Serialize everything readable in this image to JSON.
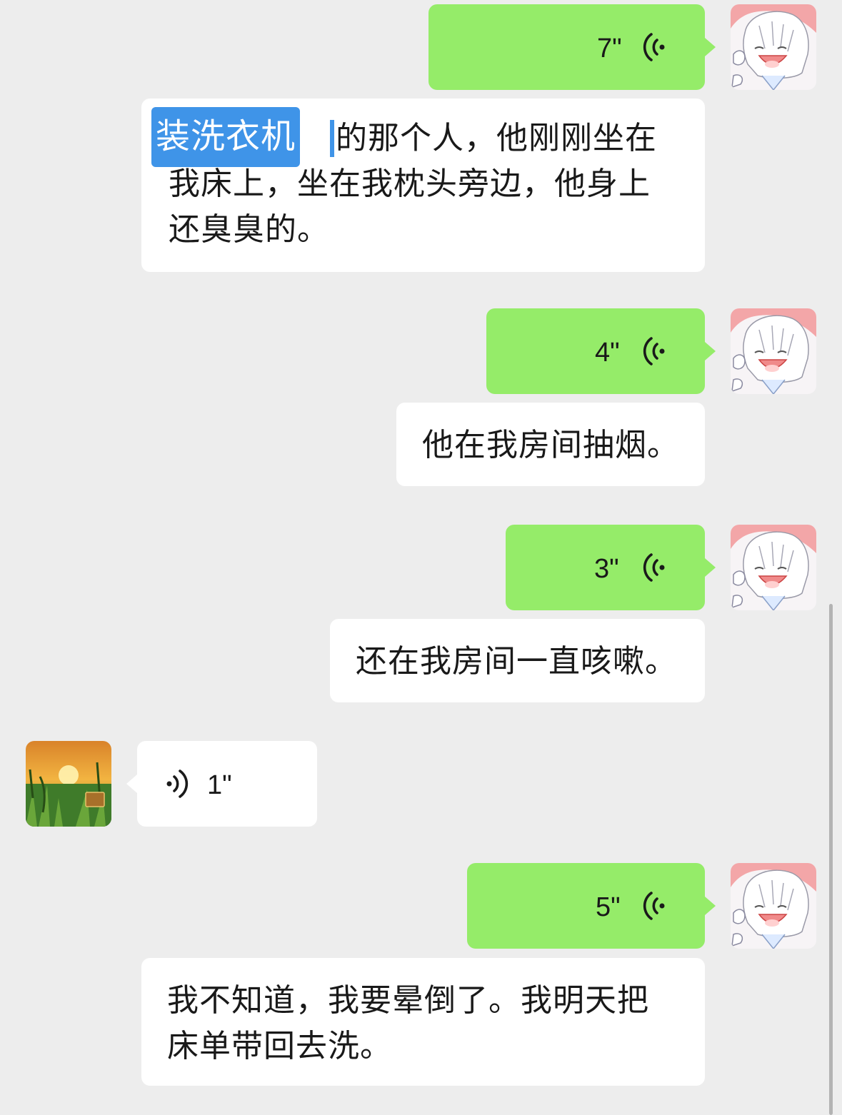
{
  "chat": {
    "messages": [
      {
        "side": "right",
        "type": "voice",
        "duration": "7\""
      },
      {
        "side": "right",
        "type": "text",
        "selected_text": "装洗衣机",
        "text_line1": "的那个人，他刚刚坐在",
        "text_line2": "我床上，坐在我枕头旁边，他身上",
        "text_line3": "还臭臭的。"
      },
      {
        "side": "right",
        "type": "voice",
        "duration": "4\""
      },
      {
        "side": "right",
        "type": "text",
        "text": "他在我房间抽烟。"
      },
      {
        "side": "right",
        "type": "voice",
        "duration": "3\""
      },
      {
        "side": "right",
        "type": "text",
        "text": "还在我房间一直咳嗽。"
      },
      {
        "side": "left",
        "type": "voice",
        "duration": "1\""
      },
      {
        "side": "right",
        "type": "voice",
        "duration": "5\""
      },
      {
        "side": "right",
        "type": "text",
        "text_line1": "我不知道，我要晕倒了。我明天把",
        "text_line2": "床单带回去洗。"
      }
    ]
  },
  "colors": {
    "background": "#ededed",
    "sent_bubble": "#95ec69",
    "received_bubble": "#ffffff",
    "selection": "#3f94e8"
  },
  "icons": {
    "self_avatar": "anime-girl-avatar",
    "contact_avatar": "sunset-field-avatar",
    "voice": "voice-wave-icon"
  }
}
